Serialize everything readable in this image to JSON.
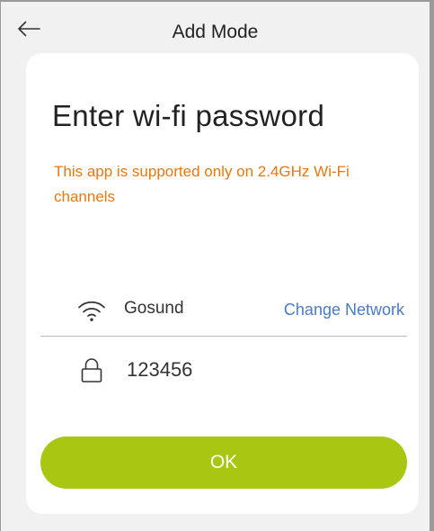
{
  "header": {
    "title": "Add Mode",
    "back_icon": "arrow-left-icon"
  },
  "card": {
    "title": "Enter wi-fi password",
    "warning": "This app is supported only on 2.4GHz Wi-Fi channels"
  },
  "network": {
    "icon": "wifi-icon",
    "ssid": "Gosund",
    "change_label": "Change Network"
  },
  "password": {
    "icon": "lock-icon",
    "value": "123456"
  },
  "ok_button": {
    "label": "OK"
  },
  "colors": {
    "background": "#f1f1f1",
    "card": "#ffffff",
    "warning": "#e8780e",
    "link": "#4a7bc0",
    "button": "#a9c712",
    "button_text": "#ffffff"
  }
}
